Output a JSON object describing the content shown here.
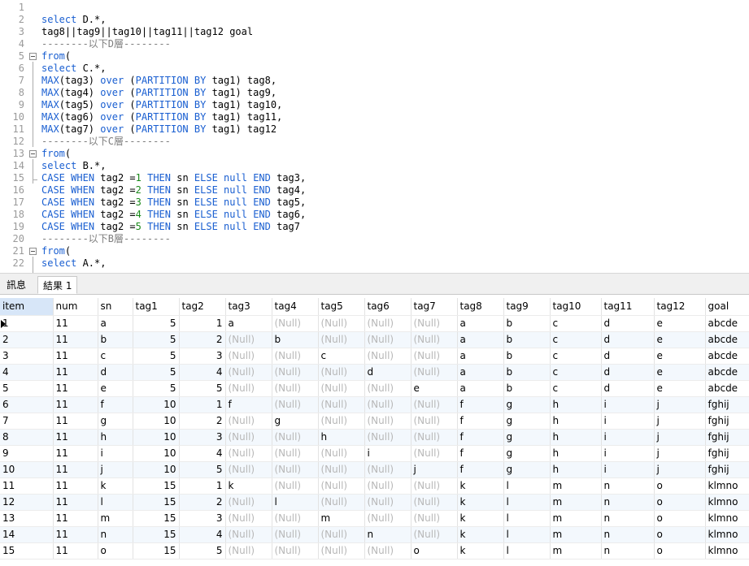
{
  "editor": {
    "lines": [
      {
        "n": "1",
        "tokens": []
      },
      {
        "n": "2",
        "tokens": [
          {
            "t": "select D.*,",
            "c": "kwmix"
          }
        ]
      },
      {
        "n": "3",
        "tokens": [
          {
            "t": "tag8||tag9||tag10||tag11||tag12 goal",
            "c": "txt"
          }
        ]
      },
      {
        "n": "4",
        "tokens": [
          {
            "t": "--------以下D層--------",
            "c": "cm"
          }
        ]
      },
      {
        "n": "5",
        "tokens": [
          {
            "t": "from(",
            "c": "kw"
          }
        ]
      },
      {
        "n": "6",
        "tokens": [
          {
            "t": "select C.*,",
            "c": "kwmix"
          }
        ]
      },
      {
        "n": "7",
        "tokens": [
          {
            "t": "MAX(tag3) over (PARTITION BY tag1) tag8,",
            "c": "agg"
          }
        ]
      },
      {
        "n": "8",
        "tokens": [
          {
            "t": "MAX(tag4) over (PARTITION BY tag1) tag9,",
            "c": "agg"
          }
        ]
      },
      {
        "n": "9",
        "tokens": [
          {
            "t": "MAX(tag5) over (PARTITION BY tag1) tag10,",
            "c": "agg"
          }
        ]
      },
      {
        "n": "10",
        "tokens": [
          {
            "t": "MAX(tag6) over (PARTITION BY tag1) tag11,",
            "c": "agg"
          }
        ]
      },
      {
        "n": "11",
        "tokens": [
          {
            "t": "MAX(tag7) over (PARTITION BY tag1) tag12",
            "c": "agg"
          }
        ]
      },
      {
        "n": "12",
        "tokens": [
          {
            "t": "--------以下C層--------",
            "c": "cm"
          }
        ]
      },
      {
        "n": "13",
        "tokens": [
          {
            "t": "from(",
            "c": "kw"
          }
        ]
      },
      {
        "n": "14",
        "tokens": [
          {
            "t": "select B.*,",
            "c": "kwmix"
          }
        ]
      },
      {
        "n": "15",
        "tokens": [
          {
            "t": "CASE WHEN tag2 =1 THEN sn ELSE null END tag3,",
            "c": "case"
          }
        ]
      },
      {
        "n": "16",
        "tokens": [
          {
            "t": "CASE WHEN tag2 =2 THEN sn ELSE null END tag4,",
            "c": "case"
          }
        ]
      },
      {
        "n": "17",
        "tokens": [
          {
            "t": "CASE WHEN tag2 =3 THEN sn ELSE null END tag5,",
            "c": "case"
          }
        ]
      },
      {
        "n": "18",
        "tokens": [
          {
            "t": "CASE WHEN tag2 =4 THEN sn ELSE null END tag6,",
            "c": "case"
          }
        ]
      },
      {
        "n": "19",
        "tokens": [
          {
            "t": "CASE WHEN tag2 =5 THEN sn ELSE null END tag7",
            "c": "case"
          }
        ]
      },
      {
        "n": "20",
        "tokens": [
          {
            "t": "--------以下B層--------",
            "c": "cm"
          }
        ]
      },
      {
        "n": "21",
        "tokens": [
          {
            "t": "from(",
            "c": "kw"
          }
        ]
      },
      {
        "n": "22",
        "tokens": [
          {
            "t": "select A.*,",
            "c": "kwmix"
          }
        ]
      }
    ]
  },
  "tabs": [
    {
      "label": "訊息",
      "active": false
    },
    {
      "label": "結果 1",
      "active": true
    }
  ],
  "grid": {
    "columns": [
      "item",
      "num",
      "sn",
      "tag1",
      "tag2",
      "tag3",
      "tag4",
      "tag5",
      "tag6",
      "tag7",
      "tag8",
      "tag9",
      "tag10",
      "tag11",
      "tag12",
      "goal"
    ],
    "null_label": "(Null)",
    "rows": [
      [
        "1",
        "11",
        "a",
        "5",
        "1",
        "a",
        null,
        null,
        null,
        null,
        "a",
        "b",
        "c",
        "d",
        "e",
        "abcde"
      ],
      [
        "2",
        "11",
        "b",
        "5",
        "2",
        null,
        "b",
        null,
        null,
        null,
        "a",
        "b",
        "c",
        "d",
        "e",
        "abcde"
      ],
      [
        "3",
        "11",
        "c",
        "5",
        "3",
        null,
        null,
        "c",
        null,
        null,
        "a",
        "b",
        "c",
        "d",
        "e",
        "abcde"
      ],
      [
        "4",
        "11",
        "d",
        "5",
        "4",
        null,
        null,
        null,
        "d",
        null,
        "a",
        "b",
        "c",
        "d",
        "e",
        "abcde"
      ],
      [
        "5",
        "11",
        "e",
        "5",
        "5",
        null,
        null,
        null,
        null,
        "e",
        "a",
        "b",
        "c",
        "d",
        "e",
        "abcde"
      ],
      [
        "6",
        "11",
        "f",
        "10",
        "1",
        "f",
        null,
        null,
        null,
        null,
        "f",
        "g",
        "h",
        "i",
        "j",
        "fghij"
      ],
      [
        "7",
        "11",
        "g",
        "10",
        "2",
        null,
        "g",
        null,
        null,
        null,
        "f",
        "g",
        "h",
        "i",
        "j",
        "fghij"
      ],
      [
        "8",
        "11",
        "h",
        "10",
        "3",
        null,
        null,
        "h",
        null,
        null,
        "f",
        "g",
        "h",
        "i",
        "j",
        "fghij"
      ],
      [
        "9",
        "11",
        "i",
        "10",
        "4",
        null,
        null,
        null,
        "i",
        null,
        "f",
        "g",
        "h",
        "i",
        "j",
        "fghij"
      ],
      [
        "10",
        "11",
        "j",
        "10",
        "5",
        null,
        null,
        null,
        null,
        "j",
        "f",
        "g",
        "h",
        "i",
        "j",
        "fghij"
      ],
      [
        "11",
        "11",
        "k",
        "15",
        "1",
        "k",
        null,
        null,
        null,
        null,
        "k",
        "l",
        "m",
        "n",
        "o",
        "klmno"
      ],
      [
        "12",
        "11",
        "l",
        "15",
        "2",
        null,
        "l",
        null,
        null,
        null,
        "k",
        "l",
        "m",
        "n",
        "o",
        "klmno"
      ],
      [
        "13",
        "11",
        "m",
        "15",
        "3",
        null,
        null,
        "m",
        null,
        null,
        "k",
        "l",
        "m",
        "n",
        "o",
        "klmno"
      ],
      [
        "14",
        "11",
        "n",
        "15",
        "4",
        null,
        null,
        null,
        "n",
        null,
        "k",
        "l",
        "m",
        "n",
        "o",
        "klmno"
      ],
      [
        "15",
        "11",
        "o",
        "15",
        "5",
        null,
        null,
        null,
        null,
        "o",
        "k",
        "l",
        "m",
        "n",
        "o",
        "klmno"
      ]
    ]
  }
}
